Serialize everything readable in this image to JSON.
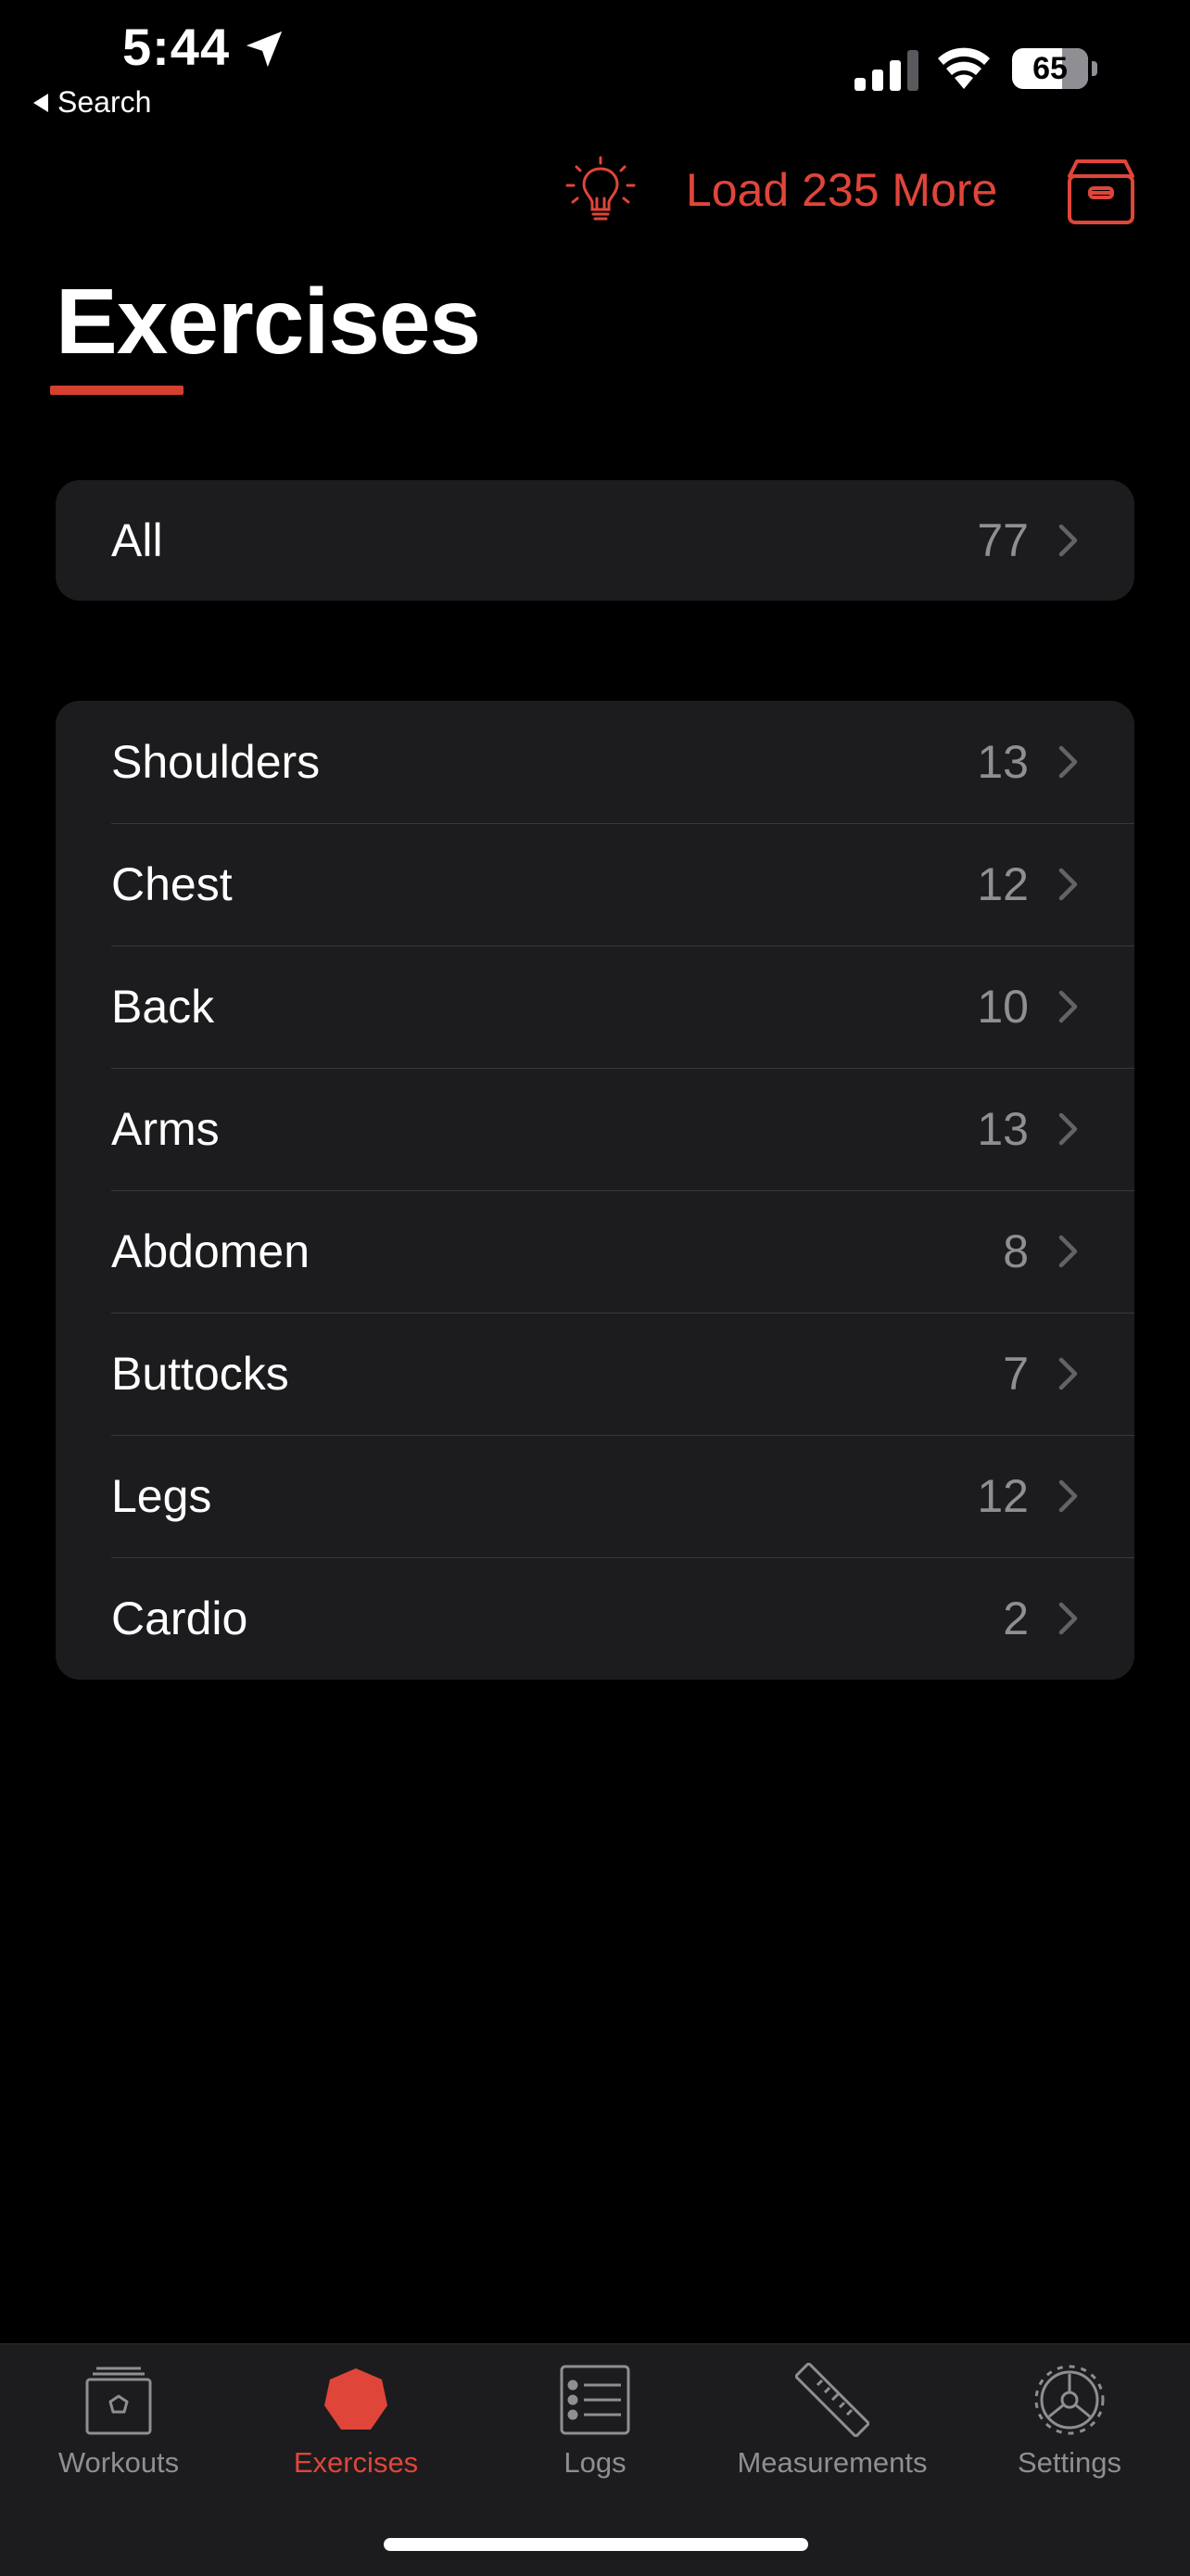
{
  "status_bar": {
    "time": "5:44",
    "back_label": "Search",
    "battery": "65"
  },
  "toolbar": {
    "load_more_label": "Load 235 More",
    "tip_icon": "lightbulb-icon",
    "archive_icon": "archive-box-icon",
    "accent_color": "#e0453a"
  },
  "page": {
    "title": "Exercises"
  },
  "all_group": {
    "label": "All",
    "count": "77"
  },
  "categories": [
    {
      "label": "Shoulders",
      "count": "13"
    },
    {
      "label": "Chest",
      "count": "12"
    },
    {
      "label": "Back",
      "count": "10"
    },
    {
      "label": "Arms",
      "count": "13"
    },
    {
      "label": "Abdomen",
      "count": "8"
    },
    {
      "label": "Buttocks",
      "count": "7"
    },
    {
      "label": "Legs",
      "count": "12"
    },
    {
      "label": "Cardio",
      "count": "2"
    }
  ],
  "tab_bar": {
    "tabs": [
      {
        "label": "Workouts",
        "icon": "workouts-icon",
        "active": false
      },
      {
        "label": "Exercises",
        "icon": "exercises-icon",
        "active": true
      },
      {
        "label": "Logs",
        "icon": "logs-list-icon",
        "active": false
      },
      {
        "label": "Measurements",
        "icon": "ruler-icon",
        "active": false
      },
      {
        "label": "Settings",
        "icon": "settings-gear-icon",
        "active": false
      }
    ]
  }
}
